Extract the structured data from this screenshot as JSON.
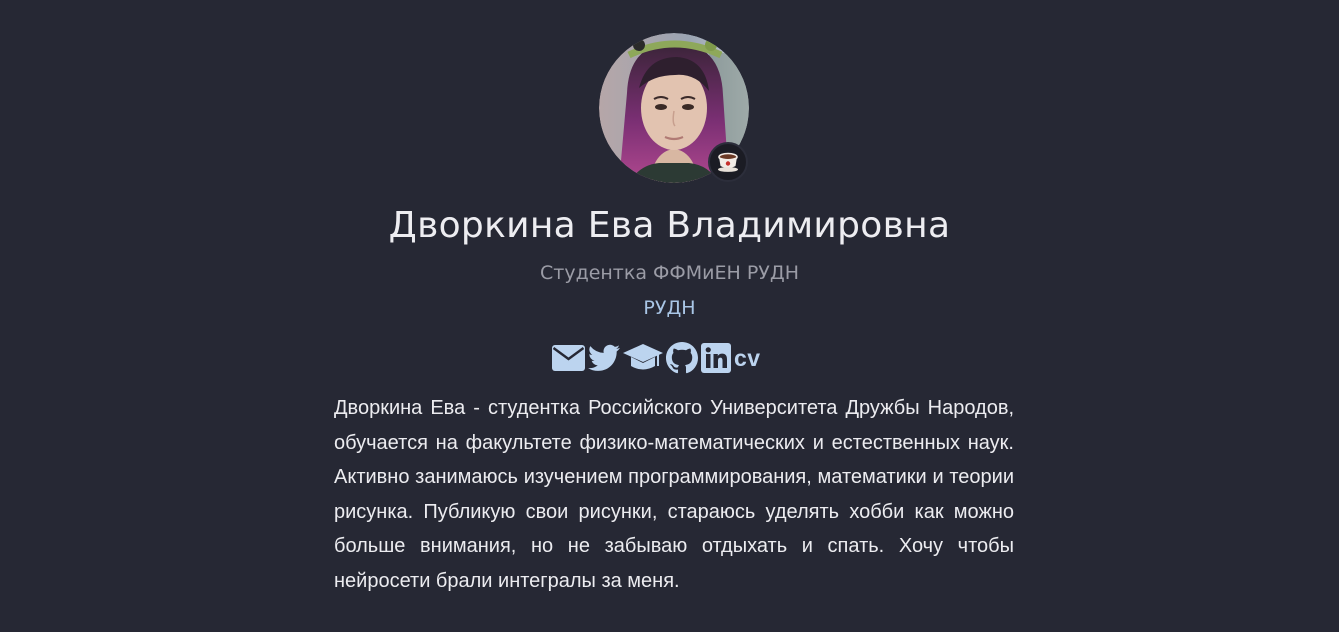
{
  "profile": {
    "name": "Дворкина Ева Владимировна",
    "role": "Студентка ФФМиЕН РУДН",
    "organization": "РУДН",
    "status_emoji": "☕",
    "bio": "Дворкина Ева - студентка Российского Университета Дружбы Народов, обучается на факультете физико-математических и естественных наук. Активно занимаюсь изучением программирования, математики и теории рисунка. Публикую свои рисунки, стараюсь уделять хобби как можно больше внимания, но не забываю отдыхать и спать. Хочу чтобы нейросети брали интегралы за меня."
  },
  "social_links": [
    {
      "icon": "envelope-icon"
    },
    {
      "icon": "twitter-icon"
    },
    {
      "icon": "graduation-cap-icon"
    },
    {
      "icon": "github-icon"
    },
    {
      "icon": "linkedin-icon"
    },
    {
      "icon": "cv-icon",
      "label": "cv"
    }
  ],
  "colors": {
    "background": "#262834",
    "link": "#a9c6e6",
    "icon": "#bcd4ef",
    "muted_text": "#9b9ca6",
    "text": "#ececf0"
  }
}
